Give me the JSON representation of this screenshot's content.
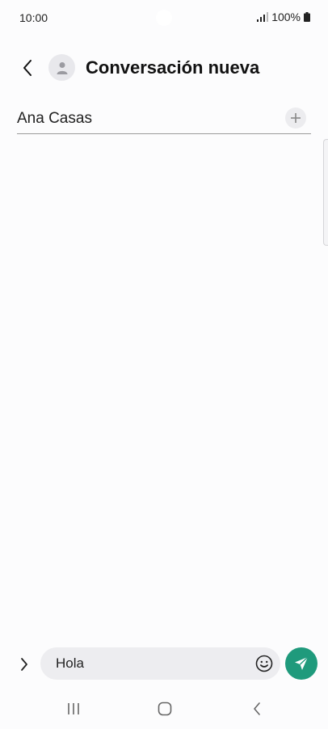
{
  "status_bar": {
    "time": "10:00",
    "battery": "100%",
    "icons": [
      "signal-icon",
      "battery-icon"
    ]
  },
  "header": {
    "title": "Conversación nueva",
    "icons": [
      "back-arrow-icon",
      "contact-avatar-icon"
    ]
  },
  "recipient": {
    "name": "Ana Casas",
    "add_icon": "plus-icon"
  },
  "composer": {
    "message_value": "Hola",
    "icons": [
      "chevron-right-icon",
      "emoji-icon",
      "send-icon"
    ]
  },
  "nav": {
    "icons": [
      "recent-apps-icon",
      "home-icon",
      "back-icon"
    ]
  },
  "colors": {
    "accent": "#1f9a7c",
    "background": "#fcfcfd",
    "field": "#ededf0"
  }
}
